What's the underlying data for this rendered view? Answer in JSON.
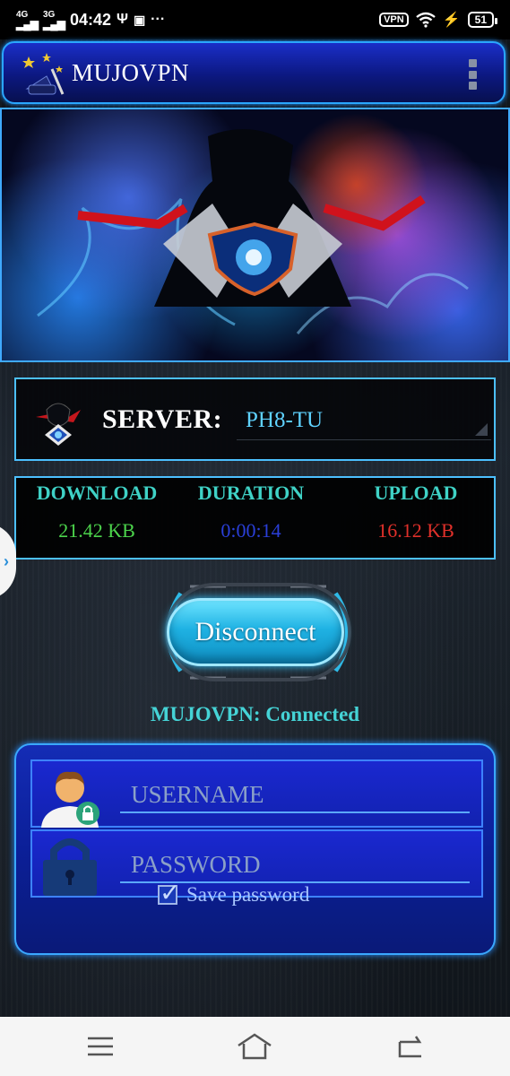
{
  "status_bar": {
    "signal_1": "4G",
    "signal_2": "3G",
    "time": "04:42",
    "vpn": "VPN",
    "battery": "51"
  },
  "header": {
    "title": "MUJOVPN"
  },
  "server": {
    "label": "SERVER:",
    "selected": "PH8-TU"
  },
  "stats": {
    "download_label": "DOWNLOAD",
    "download_value": "21.42 KB",
    "duration_label": "DURATION",
    "duration_value": "0:00:14",
    "upload_label": "UPLOAD",
    "upload_value": "16.12 KB"
  },
  "colors": {
    "download": "#4cd44c",
    "duration": "#2a3fd8",
    "upload": "#e0302a"
  },
  "actions": {
    "disconnect_label": "Disconnect"
  },
  "connection_status": "MUJOVPN: Connected",
  "login": {
    "username_placeholder": "USERNAME",
    "password_placeholder": "PASSWORD",
    "save_password_label": "Save password",
    "save_password_checked": true
  },
  "icons": {
    "menu": "more-vert-icon",
    "user": "user-avatar-icon",
    "lock": "padlock-icon",
    "nav_menu": "menu-icon",
    "nav_home": "home-icon",
    "nav_back": "back-icon"
  }
}
